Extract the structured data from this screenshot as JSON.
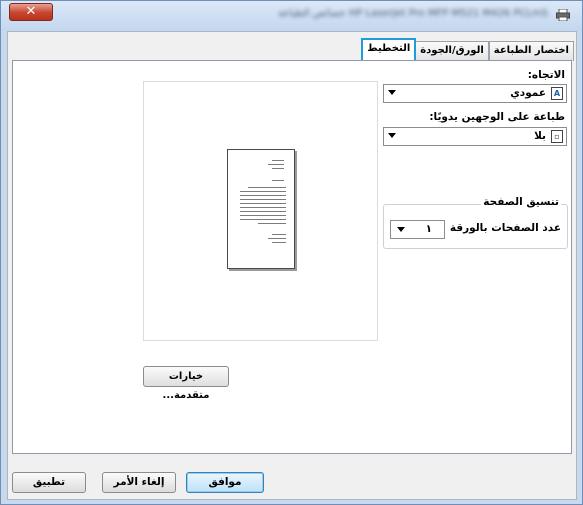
{
  "window": {
    "title": "HP LaserJet Pro MFP M521 M426 PCLmS خصائص الطباعة",
    "close_label": "✕"
  },
  "tabs": [
    {
      "label": "التخطيط",
      "active": true
    },
    {
      "label": "الورق/الجودة",
      "active": false
    },
    {
      "label": "اختصار الطباعة",
      "active": false
    }
  ],
  "orientation": {
    "label": "الاتجاه:",
    "value": "عمودي",
    "icon": "A"
  },
  "duplex": {
    "label": "طباعة على الوجهين يدويًا:",
    "value": "بلا"
  },
  "page_layout": {
    "legend": "تنسيق الصفحة",
    "pages_per_sheet_label": "عدد الصفحات بالورقة",
    "pages_per_sheet_value": "١"
  },
  "advanced_button": "خيارات متقدمة...",
  "buttons": {
    "ok": "موافق",
    "cancel": "إلغاء الأمر",
    "apply": "تطبيق"
  },
  "colors": {
    "active_tab_outline": "#1f9bde",
    "close_button": "#c7442e"
  }
}
